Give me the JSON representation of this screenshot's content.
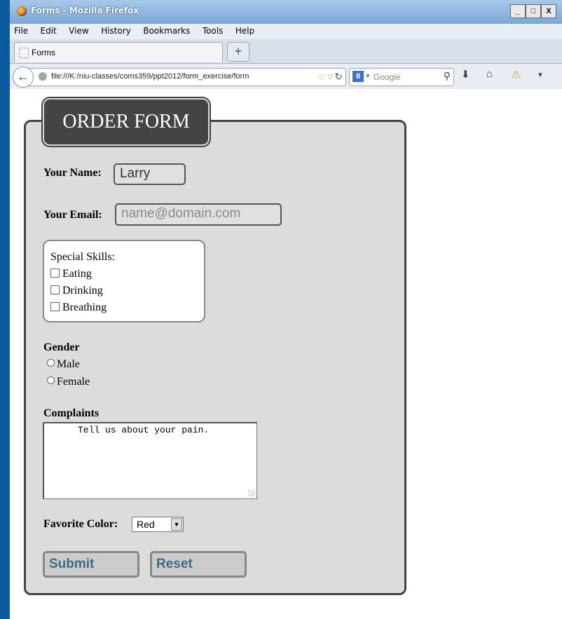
{
  "window": {
    "title": "Forms - Mozilla Firefox",
    "min": "_",
    "max": "□",
    "close": "X"
  },
  "menu": [
    "File",
    "Edit",
    "View",
    "History",
    "Bookmarks",
    "Tools",
    "Help"
  ],
  "tab": {
    "label": "Forms",
    "new_tab": "+"
  },
  "nav": {
    "url": "file:///K:/niu-classes/coms359/ppt2012/form_exercise/form",
    "search_placeholder": "Google",
    "search_engine": "8"
  },
  "form": {
    "legend": "ORDER FORM",
    "name_label": "Your Name:",
    "name_value": "Larry",
    "email_label": "Your Email:",
    "email_placeholder": "name@domain.com",
    "skills_title": "Special Skills:",
    "skills": [
      "Eating",
      "Drinking",
      "Breathing"
    ],
    "gender_label": "Gender",
    "genders": [
      "Male",
      "Female"
    ],
    "complaints_label": "Complaints",
    "complaints_text": "Tell us about your pain.",
    "color_label": "Favorite Color:",
    "color_value": "Red",
    "submit_label": "Submit",
    "reset_label": "Reset"
  }
}
